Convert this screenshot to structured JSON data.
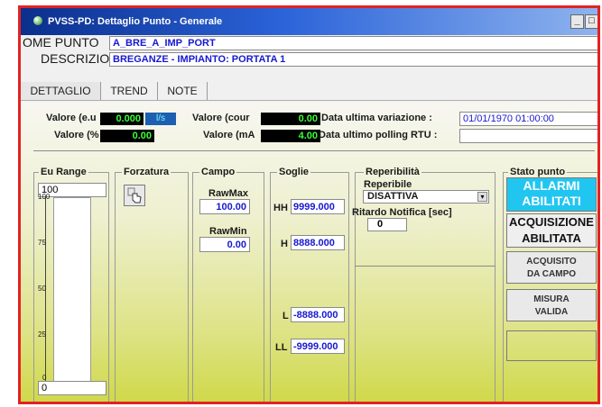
{
  "window": {
    "title": "PVSS-PD: Dettaglio Punto - Generale",
    "buttons": {
      "minimize": "_",
      "maximize": "□",
      "close": "×"
    }
  },
  "header": {
    "nome_label": "OME PUNTO",
    "nome_value": "A_BRE_A_IMP_PORT",
    "descr_label": "DESCRIZION",
    "descr_value": "BREGANZE  - IMPIANTO: PORTATA 1"
  },
  "tabs": [
    "DETTAGLIO",
    "TREND",
    "NOTE"
  ],
  "values": {
    "valore_eu_label": "Valore (e.u",
    "valore_eu": "0.000",
    "unit": "l/s",
    "valore_pct_label": "Valore (%",
    "valore_pct": "0.00",
    "valore_count_label": "Valore (cour",
    "valore_count": "0.00",
    "valore_ma_label": "Valore (mA",
    "valore_ma": "4.00",
    "data_var_label": "Data ultima variazione :",
    "data_var": "01/01/1970 01:00:00",
    "data_poll_label": "Data ultimo polling RTU :",
    "data_poll": ""
  },
  "eu_range": {
    "title": "Eu Range",
    "top_value": "100",
    "bottom_value": "0",
    "ticks": [
      "100",
      "75",
      "50",
      "25",
      "0"
    ],
    "level": 0
  },
  "forzatura": {
    "title": "Forzatura",
    "icon": "hand-pointer-icon"
  },
  "campo": {
    "title": "Campo",
    "rawmax_label": "RawMax",
    "rawmax_value": "100.00",
    "rawmin_label": "RawMin",
    "rawmin_value": "0.00"
  },
  "soglie": {
    "title": "Soglie",
    "hh_label": "HH",
    "hh_value": "9999.000",
    "h_label": "H",
    "h_value": "8888.000",
    "l_label": "L",
    "l_value": "-8888.000",
    "ll_label": "LL",
    "ll_value": "-9999.000"
  },
  "reperibilita": {
    "title": "Reperibilità",
    "reperibile_label": "Reperibile",
    "reperibile_value": "DISATTIVA",
    "ritardo_label": "Ritardo Notifica [sec]",
    "ritardo_value": "0"
  },
  "stato": {
    "title": "Stato punto",
    "allarmi_line1": "ALLARMI",
    "allarmi_line2": "ABILITATI",
    "acq_line1": "ACQUISIZIONE",
    "acq_line2": "ABILITATA",
    "acquisito_line1": "ACQUISITO",
    "acquisito_line2": "DA CAMPO",
    "misura_line1": "MISURA",
    "misura_line2": "VALIDA"
  },
  "colors": {
    "border_red": "#e32222",
    "titlebar_blue": "#0b2f8c",
    "value_blue": "#1818d0",
    "led_green": "#3aff38",
    "allarmi_cyan": "#21c6f0"
  }
}
